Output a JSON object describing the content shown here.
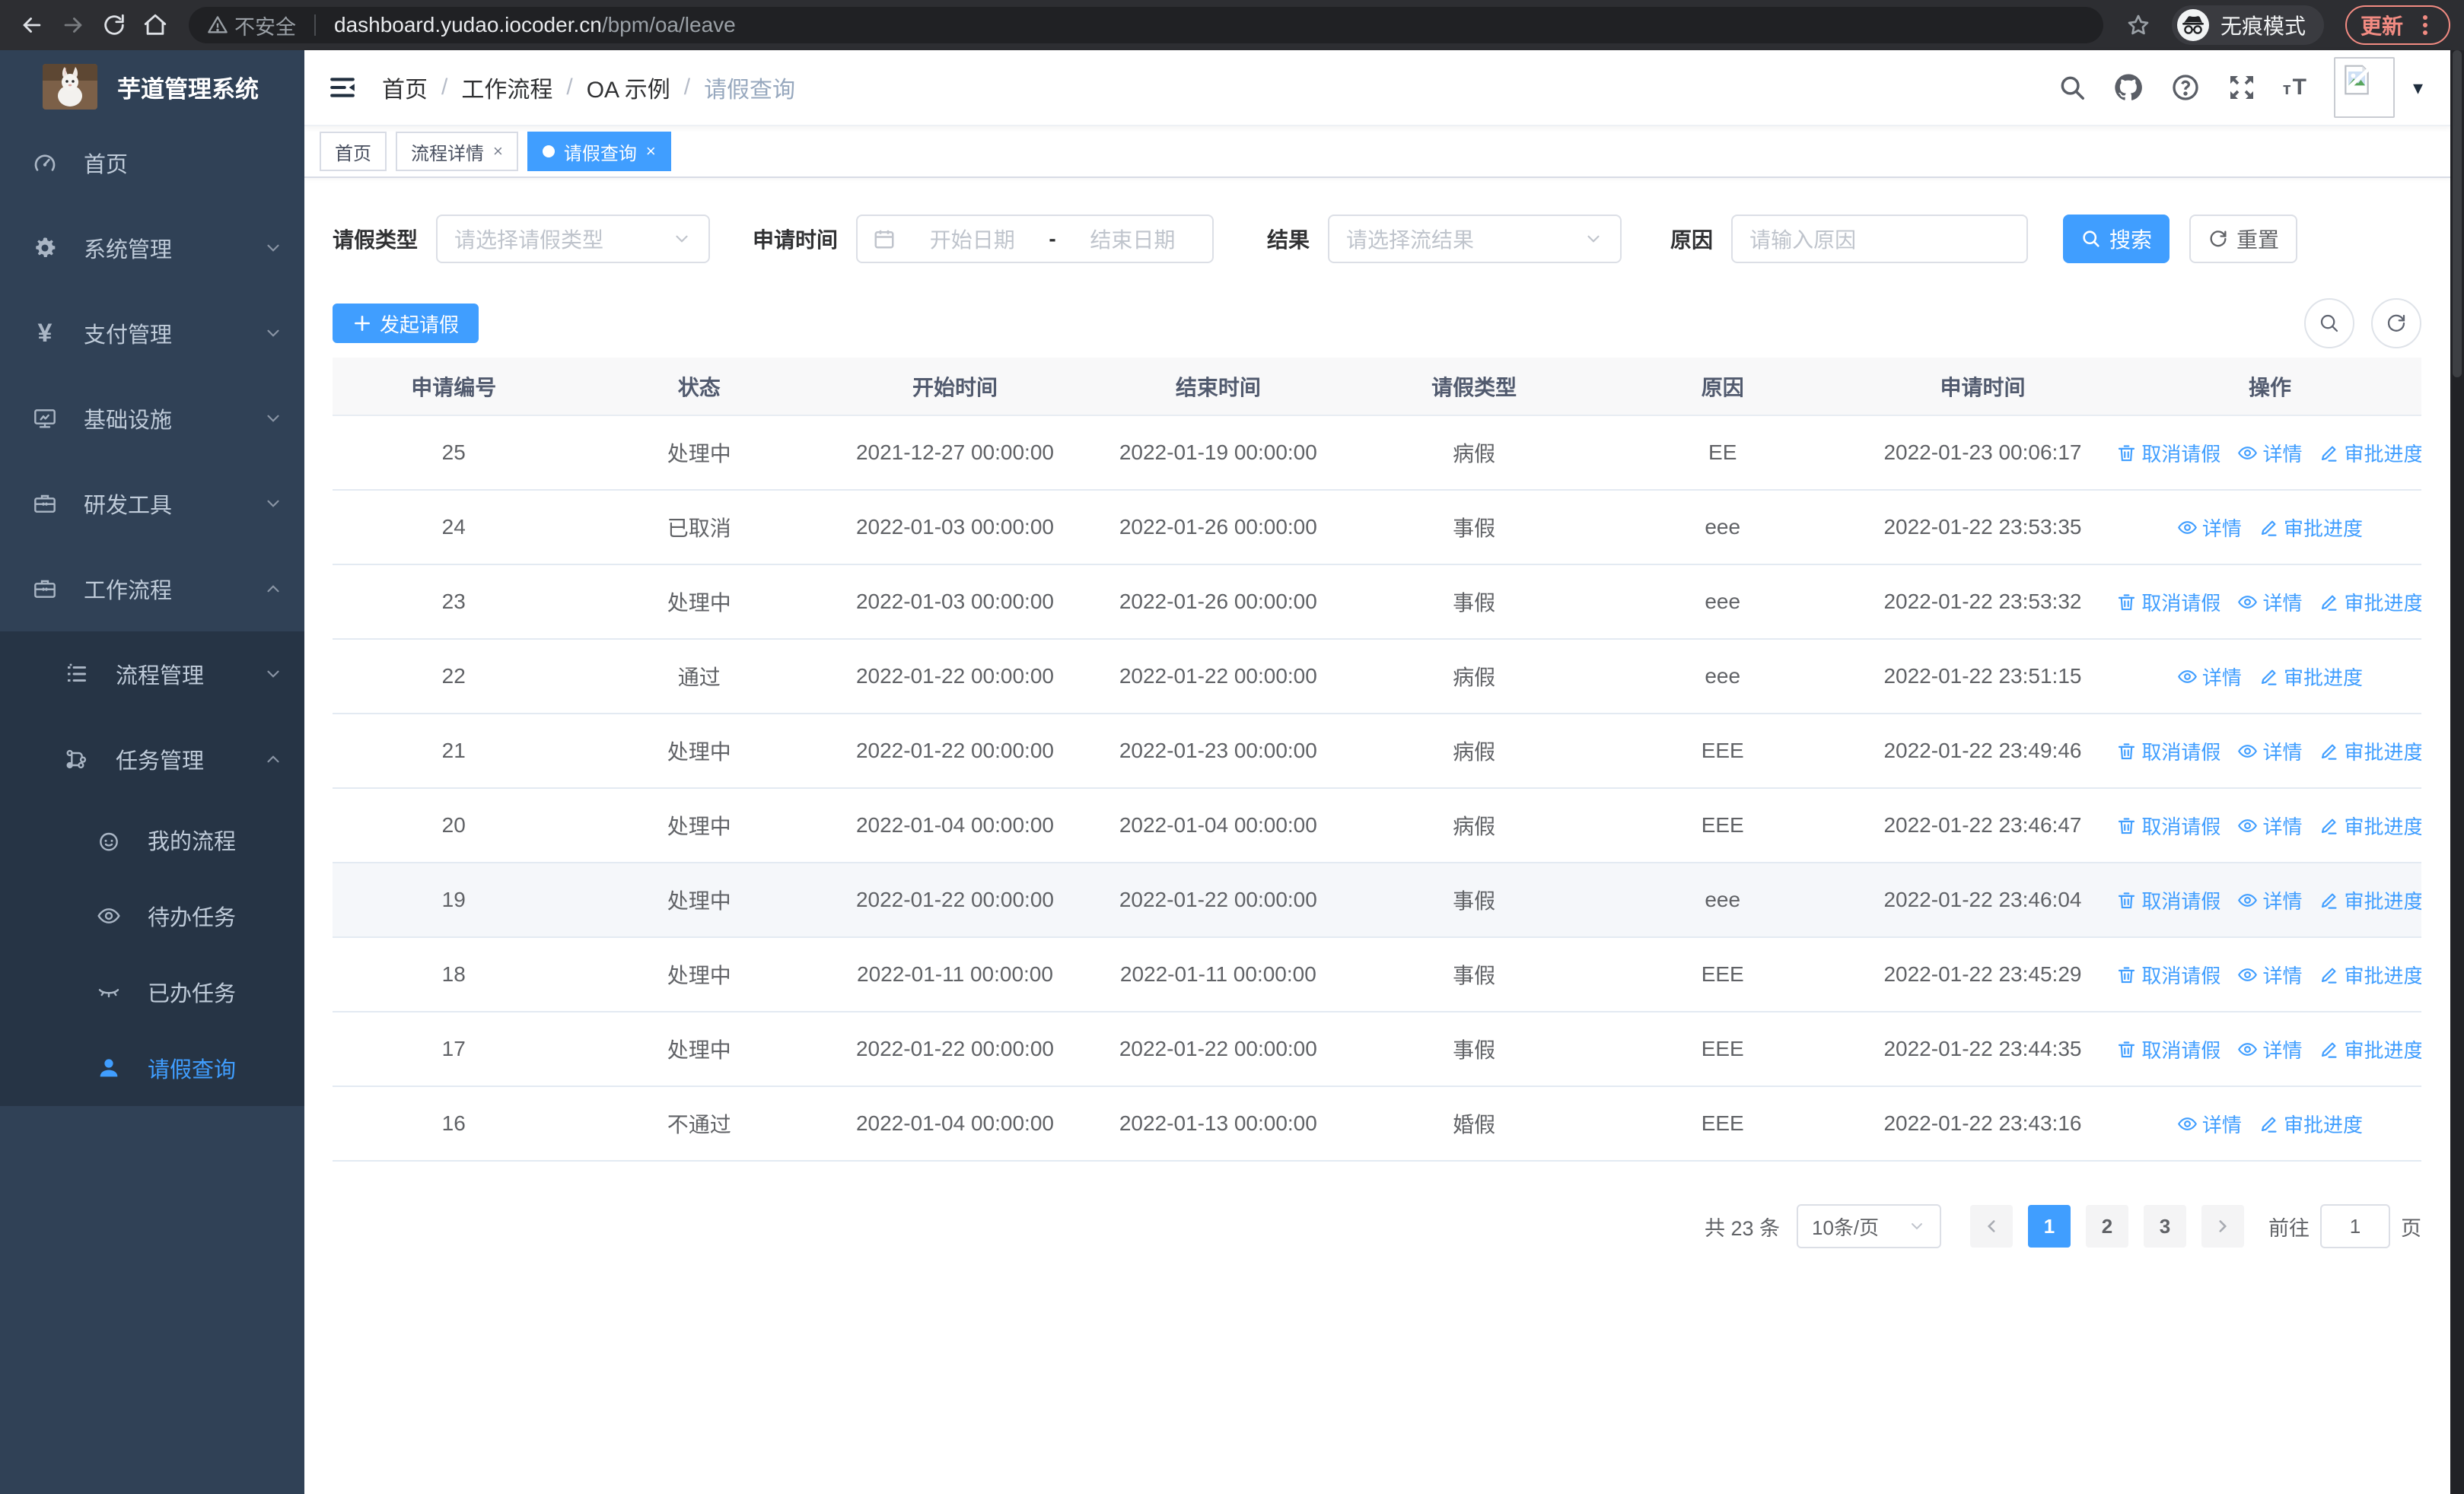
{
  "colors": {
    "accent": "#409EFF",
    "sidebar_bg": "#304156",
    "submenu_bg": "#263445",
    "update_accent": "#F28B82"
  },
  "browser": {
    "not_secure": "不安全",
    "url_host": "dashboard.yudao.iocoder.cn",
    "url_path": "/bpm/oa/leave",
    "incognito": "无痕模式",
    "update": "更新"
  },
  "sidebar": {
    "title": "芋道管理系统",
    "items": [
      {
        "id": "home",
        "label": "首页",
        "icon": "gauge",
        "level": 1,
        "sub": false,
        "chevron": "",
        "active": false
      },
      {
        "id": "system",
        "label": "系统管理",
        "icon": "gear",
        "level": 1,
        "sub": false,
        "chevron": "down",
        "active": false
      },
      {
        "id": "payment",
        "label": "支付管理",
        "icon": "yen",
        "level": 1,
        "sub": false,
        "chevron": "down",
        "active": false
      },
      {
        "id": "infra",
        "label": "基础设施",
        "icon": "monitor",
        "level": 1,
        "sub": false,
        "chevron": "down",
        "active": false
      },
      {
        "id": "devtools",
        "label": "研发工具",
        "icon": "briefcase",
        "level": 1,
        "sub": false,
        "chevron": "down",
        "active": false
      },
      {
        "id": "workflow",
        "label": "工作流程",
        "icon": "briefcase",
        "level": 1,
        "sub": false,
        "chevron": "up",
        "active": false
      },
      {
        "id": "process-mgmt",
        "label": "流程管理",
        "icon": "list",
        "level": 2,
        "sub": true,
        "chevron": "down",
        "active": false
      },
      {
        "id": "task-mgmt",
        "label": "任务管理",
        "icon": "tree",
        "level": 2,
        "sub": true,
        "chevron": "up",
        "active": false
      },
      {
        "id": "my-process",
        "label": "我的流程",
        "icon": "face",
        "level": 3,
        "sub": true,
        "chevron": "",
        "active": false
      },
      {
        "id": "todo-task",
        "label": "待办任务",
        "icon": "eye",
        "level": 3,
        "sub": true,
        "chevron": "",
        "active": false
      },
      {
        "id": "done-task",
        "label": "已办任务",
        "icon": "eye-closed",
        "level": 3,
        "sub": true,
        "chevron": "",
        "active": false
      },
      {
        "id": "leave-query",
        "label": "请假查询",
        "icon": "user",
        "level": 3,
        "sub": true,
        "chevron": "",
        "active": true
      }
    ]
  },
  "header": {
    "breadcrumb": [
      "首页",
      "工作流程",
      "OA 示例",
      "请假查询"
    ]
  },
  "tags": {
    "items": [
      {
        "label": "首页",
        "closable": false,
        "active": false
      },
      {
        "label": "流程详情",
        "closable": true,
        "active": false
      },
      {
        "label": "请假查询",
        "closable": true,
        "active": true
      }
    ],
    "close_glyph": "×"
  },
  "filters": {
    "type_label": "请假类型",
    "type_placeholder": "请选择请假类型",
    "time_label": "申请时间",
    "time_start": "开始日期",
    "time_separator": "-",
    "time_end": "结束日期",
    "result_label": "结果",
    "result_placeholder": "请选择流结果",
    "reason_label": "原因",
    "reason_placeholder": "请输入原因",
    "search": "搜索",
    "reset": "重置"
  },
  "toolbar": {
    "create": "发起请假"
  },
  "table": {
    "columns": [
      "申请编号",
      "状态",
      "开始时间",
      "结束时间",
      "请假类型",
      "原因",
      "申请时间",
      "操作"
    ],
    "action_defs": {
      "cancel": {
        "label": "取消请假",
        "icon": "trash"
      },
      "detail": {
        "label": "详情",
        "icon": "eye-o"
      },
      "progress": {
        "label": "审批进度",
        "icon": "edit"
      }
    },
    "rows": [
      {
        "id": "25",
        "status": "处理中",
        "start": "2021-12-27 00:00:00",
        "end": "2022-01-19 00:00:00",
        "type": "病假",
        "reason": "EE",
        "applied": "2022-01-23 00:06:17",
        "actions": [
          "cancel",
          "detail",
          "progress"
        ],
        "highlight": false
      },
      {
        "id": "24",
        "status": "已取消",
        "start": "2022-01-03 00:00:00",
        "end": "2022-01-26 00:00:00",
        "type": "事假",
        "reason": "eee",
        "applied": "2022-01-22 23:53:35",
        "actions": [
          "detail",
          "progress"
        ],
        "highlight": false
      },
      {
        "id": "23",
        "status": "处理中",
        "start": "2022-01-03 00:00:00",
        "end": "2022-01-26 00:00:00",
        "type": "事假",
        "reason": "eee",
        "applied": "2022-01-22 23:53:32",
        "actions": [
          "cancel",
          "detail",
          "progress"
        ],
        "highlight": false
      },
      {
        "id": "22",
        "status": "通过",
        "start": "2022-01-22 00:00:00",
        "end": "2022-01-22 00:00:00",
        "type": "病假",
        "reason": "eee",
        "applied": "2022-01-22 23:51:15",
        "actions": [
          "detail",
          "progress"
        ],
        "highlight": false
      },
      {
        "id": "21",
        "status": "处理中",
        "start": "2022-01-22 00:00:00",
        "end": "2022-01-23 00:00:00",
        "type": "病假",
        "reason": "EEE",
        "applied": "2022-01-22 23:49:46",
        "actions": [
          "cancel",
          "detail",
          "progress"
        ],
        "highlight": false
      },
      {
        "id": "20",
        "status": "处理中",
        "start": "2022-01-04 00:00:00",
        "end": "2022-01-04 00:00:00",
        "type": "病假",
        "reason": "EEE",
        "applied": "2022-01-22 23:46:47",
        "actions": [
          "cancel",
          "detail",
          "progress"
        ],
        "highlight": false
      },
      {
        "id": "19",
        "status": "处理中",
        "start": "2022-01-22 00:00:00",
        "end": "2022-01-22 00:00:00",
        "type": "事假",
        "reason": "eee",
        "applied": "2022-01-22 23:46:04",
        "actions": [
          "cancel",
          "detail",
          "progress"
        ],
        "highlight": true
      },
      {
        "id": "18",
        "status": "处理中",
        "start": "2022-01-11 00:00:00",
        "end": "2022-01-11 00:00:00",
        "type": "事假",
        "reason": "EEE",
        "applied": "2022-01-22 23:45:29",
        "actions": [
          "cancel",
          "detail",
          "progress"
        ],
        "highlight": false
      },
      {
        "id": "17",
        "status": "处理中",
        "start": "2022-01-22 00:00:00",
        "end": "2022-01-22 00:00:00",
        "type": "事假",
        "reason": "EEE",
        "applied": "2022-01-22 23:44:35",
        "actions": [
          "cancel",
          "detail",
          "progress"
        ],
        "highlight": false
      },
      {
        "id": "16",
        "status": "不通过",
        "start": "2022-01-04 00:00:00",
        "end": "2022-01-13 00:00:00",
        "type": "婚假",
        "reason": "EEE",
        "applied": "2022-01-22 23:43:16",
        "actions": [
          "detail",
          "progress"
        ],
        "highlight": false
      }
    ]
  },
  "pagination": {
    "total": "共 23 条",
    "page_size": "10条/页",
    "pages": [
      "1",
      "2",
      "3"
    ],
    "active_page": "1",
    "goto_label": "前往",
    "goto_value": "1",
    "unit_label": "页"
  }
}
